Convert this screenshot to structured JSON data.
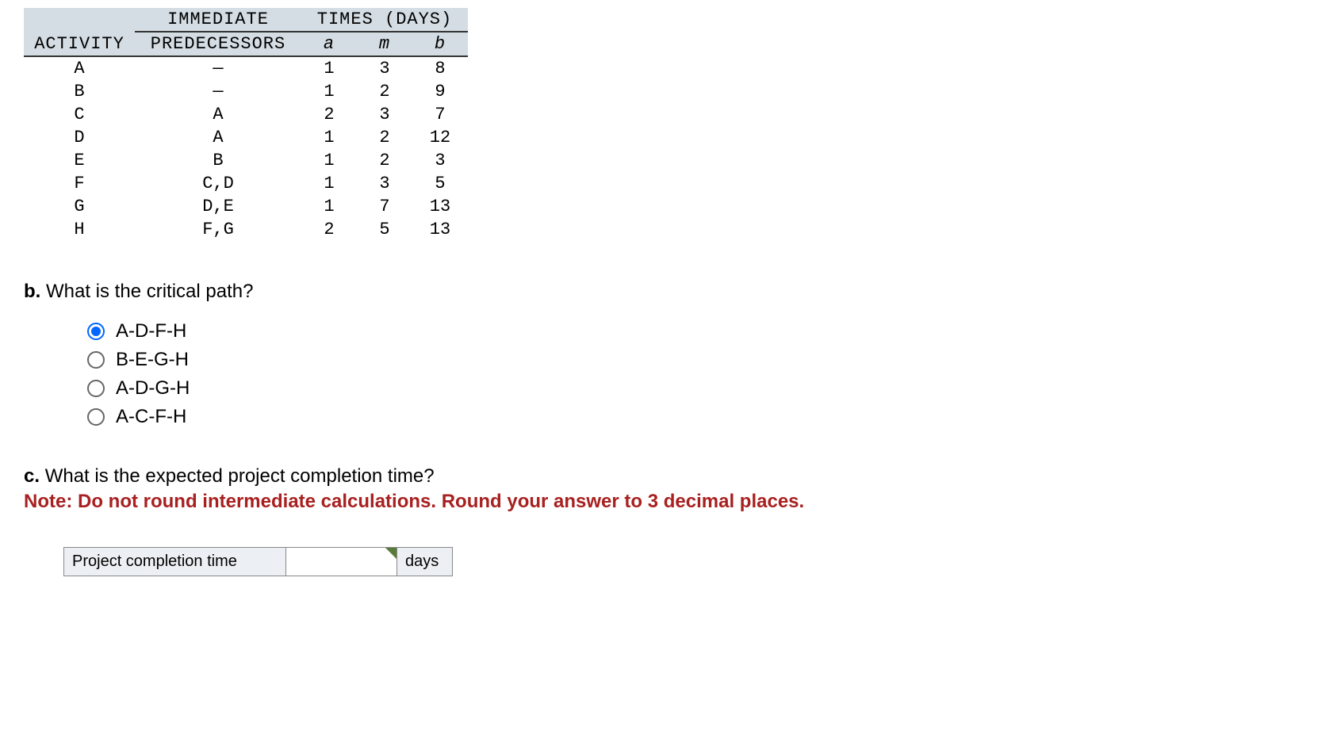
{
  "chart_data": {
    "type": "table",
    "headers": {
      "activity": "ACTIVITY",
      "predecessors_top": "IMMEDIATE",
      "predecessors_bottom": "PREDECESSORS",
      "times_header": "TIMES (DAYS)",
      "a": "a",
      "m": "m",
      "b": "b"
    },
    "rows": [
      {
        "activity": "A",
        "pred": "—",
        "a": "1",
        "m": "3",
        "b": "8"
      },
      {
        "activity": "B",
        "pred": "—",
        "a": "1",
        "m": "2",
        "b": "9"
      },
      {
        "activity": "C",
        "pred": "A",
        "a": "2",
        "m": "3",
        "b": "7"
      },
      {
        "activity": "D",
        "pred": "A",
        "a": "1",
        "m": "2",
        "b": "12"
      },
      {
        "activity": "E",
        "pred": "B",
        "a": "1",
        "m": "2",
        "b": "3"
      },
      {
        "activity": "F",
        "pred": "C,D",
        "a": "1",
        "m": "3",
        "b": "5"
      },
      {
        "activity": "G",
        "pred": "D,E",
        "a": "1",
        "m": "7",
        "b": "13"
      },
      {
        "activity": "H",
        "pred": "F,G",
        "a": "2",
        "m": "5",
        "b": "13"
      }
    ]
  },
  "question_b": {
    "label": "b.",
    "text": "What is the critical path?",
    "options": [
      {
        "label": "A-D-F-H",
        "selected": true
      },
      {
        "label": "B-E-G-H",
        "selected": false
      },
      {
        "label": "A-D-G-H",
        "selected": false
      },
      {
        "label": "A-C-F-H",
        "selected": false
      }
    ]
  },
  "question_c": {
    "label": "c.",
    "text": "What is the expected project completion time?",
    "note_prefix": "Note:",
    "note": "Do not round intermediate calculations. Round your answer to 3 decimal places."
  },
  "answer_box": {
    "label": "Project completion time",
    "value": "",
    "unit": "days"
  }
}
